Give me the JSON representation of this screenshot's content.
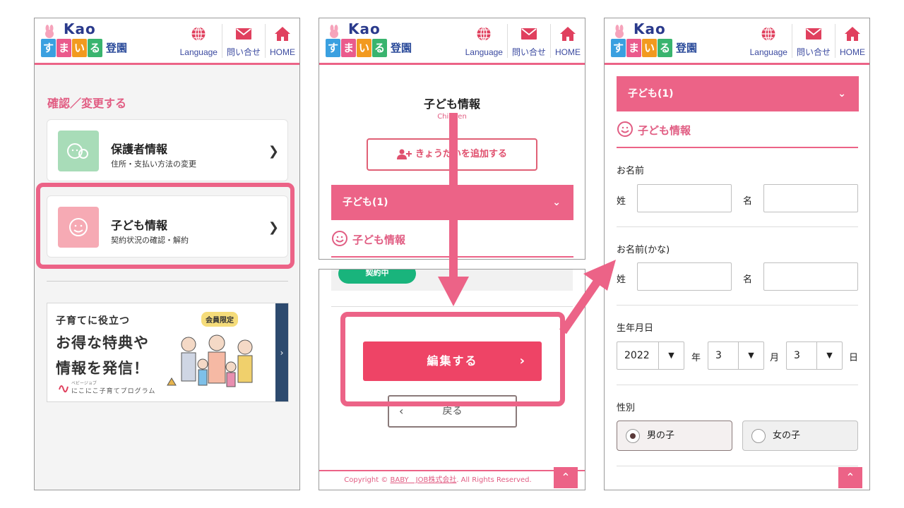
{
  "header": {
    "logo_text": "Kao",
    "logo_chars": [
      "す",
      "ま",
      "い",
      "る"
    ],
    "logo_suffix": "登園",
    "nav": [
      {
        "label": "Language",
        "icon": "globe-icon"
      },
      {
        "label": "問い合せ",
        "icon": "mail-icon"
      },
      {
        "label": "HOME",
        "icon": "home-icon"
      }
    ]
  },
  "panel1": {
    "section_title": "確認／変更する",
    "cards": [
      {
        "title": "保護者情報",
        "subtitle": "住所・支払い方法の変更",
        "icon": "parent-face-icon"
      },
      {
        "title": "子ども情報",
        "subtitle": "契約状況の確認・解約",
        "icon": "child-face-icon"
      }
    ],
    "banner": {
      "line1": "子育てに役立つ",
      "line2": "お得な特典や",
      "line3": "情報を発信！",
      "badge": "会員限定",
      "ruby": "ベビージョブ",
      "program": "にこにこ子育てプログラム"
    }
  },
  "panel2": {
    "title": "子ども情報",
    "subtitle": "Children",
    "add_sibling": "きょうだいを追加する",
    "accordion_label": "子ども(1)",
    "child_info_heading": "子ども情報",
    "status_pill": "契約中",
    "edit_button": "編集する",
    "back_button": "戻る",
    "footer_prefix": "Copyright © ",
    "footer_link": "BABY　JOB株式会社",
    "footer_suffix": ". All Rights Reserved."
  },
  "panel3": {
    "accordion_label": "子ども(1)",
    "child_info_heading": "子ども情報",
    "name_label": "お名前",
    "kana_label": "お名前(かな)",
    "last_name": "姓",
    "first_name": "名",
    "birth_label": "生年月日",
    "birth_year": "2022",
    "birth_month": "3",
    "birth_day": "3",
    "year_unit": "年",
    "month_unit": "月",
    "day_unit": "日",
    "gender_label": "性別",
    "gender_options": [
      "男の子",
      "女の子"
    ],
    "gender_selected": "男の子"
  },
  "colors": {
    "accent": "#ec6387",
    "edit_button": "#ee4466",
    "status_green": "#19b47c",
    "nav_text": "#3b4aa0"
  }
}
